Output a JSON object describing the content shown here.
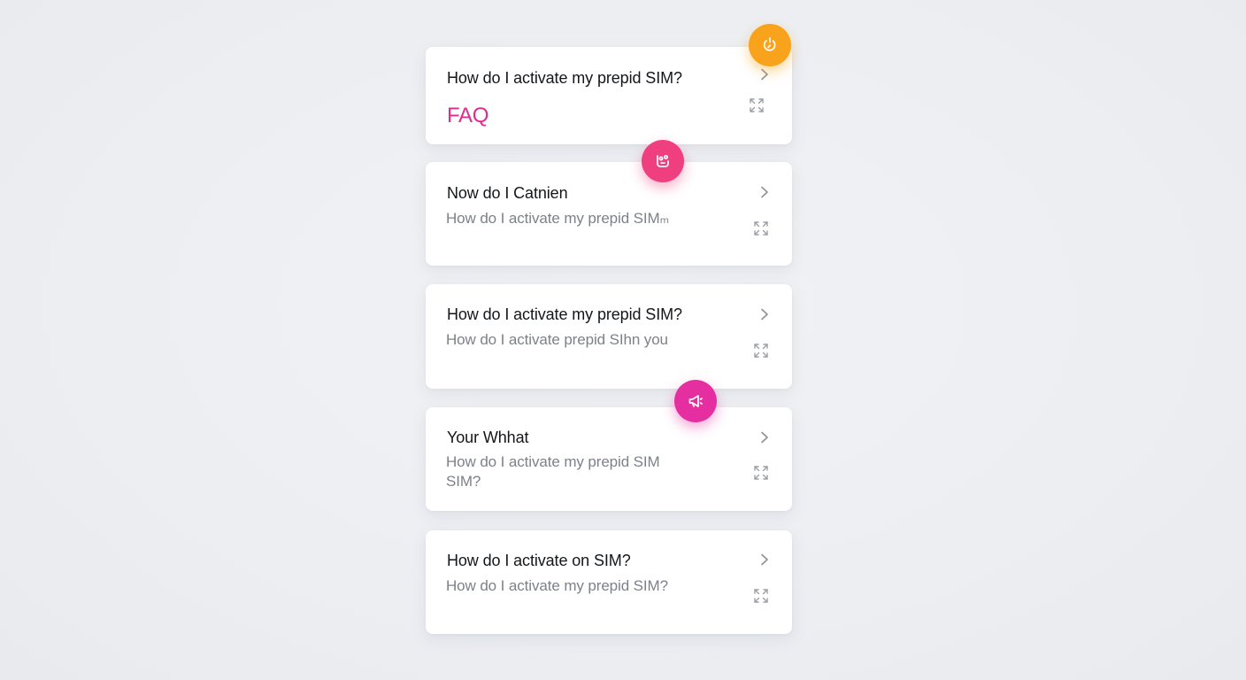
{
  "faq_header": "FAQ",
  "items": [
    {
      "question": "How do I activate my prepid SIM?",
      "answer": ""
    },
    {
      "question": "Now do I Catnien",
      "answer": "How do I activate my prepid SIMₘ"
    },
    {
      "question": "How do I activate my prepid SIM?",
      "answer": "How do I activate prepid SIhn you"
    },
    {
      "question": "Your Whhat",
      "answer": "How do I activate my prepid SIM SIM?"
    },
    {
      "question": "How do I activate on SIM?",
      "answer": "How do I activate my prepid SIM?"
    }
  ],
  "colors": {
    "accent_faq": "#e02c8d",
    "fab_orange": "#f8a31b",
    "fab_pink": "#ef3f7e",
    "fab_magenta": "#e52fa0"
  },
  "icons": {
    "chevron": "chevron-right-icon",
    "expand": "expand-icon",
    "fab_1": "timer-icon",
    "fab_2": "chat-icon",
    "fab_3": "megaphone-icon"
  }
}
